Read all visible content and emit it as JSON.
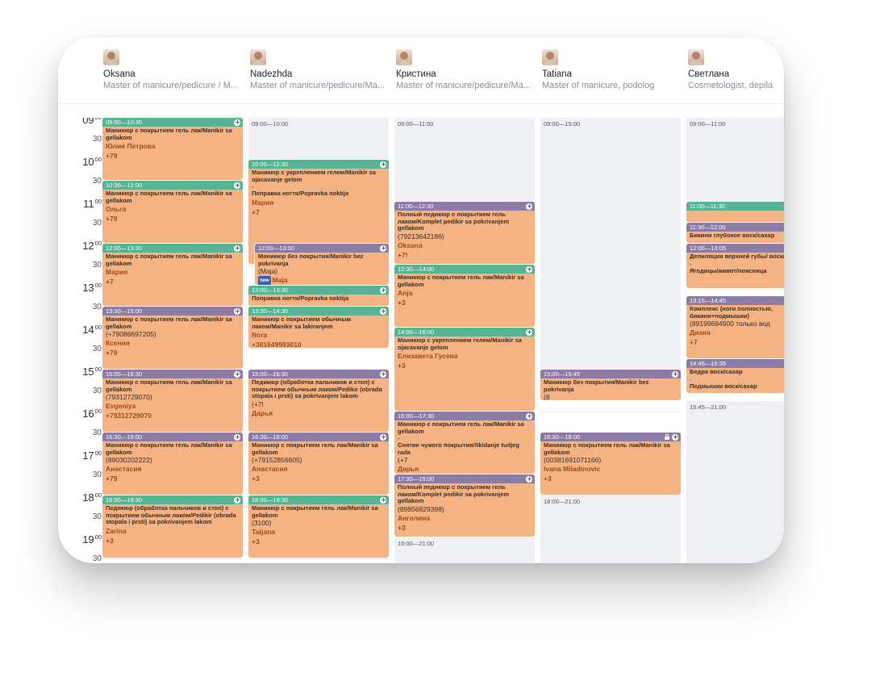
{
  "staff": [
    {
      "name": "Oksana",
      "role": "Master of manicure/pedicure / M..."
    },
    {
      "name": "Nadezhda",
      "role": "Master of manicure/pedicure/Ma..."
    },
    {
      "name": "Кристина",
      "role": "Master of manicure/pedicure/Ma..."
    },
    {
      "name": "Tatiana",
      "role": "Master of manicure, podolog"
    },
    {
      "name": "Светлана",
      "role": "Cosmetologist, depila"
    }
  ],
  "times": [
    {
      "hour": "09",
      "min": "00",
      "half": "30"
    },
    {
      "hour": "10",
      "min": "00",
      "half": "30"
    },
    {
      "hour": "11",
      "min": "00",
      "half": "30"
    },
    {
      "hour": "12",
      "min": "00",
      "half": "30"
    },
    {
      "hour": "13",
      "min": "00",
      "half": "30"
    },
    {
      "hour": "14",
      "min": "00",
      "half": "30"
    },
    {
      "hour": "15",
      "min": "00",
      "half": "30"
    },
    {
      "hour": "16",
      "min": "00",
      "half": "30"
    },
    {
      "hour": "17",
      "min": "00",
      "half": "30"
    },
    {
      "hour": "18",
      "min": "00",
      "half": "30"
    },
    {
      "hour": "19",
      "min": "00",
      "half": "30"
    }
  ],
  "columns": [
    {
      "avail": [],
      "appts": [
        {
          "time": "09:00—10:30",
          "color": "green",
          "service": "Маникюр с покрытием гель лак/Manikir sa gellakom",
          "client": "Юлия Петрова",
          "extra": "+79"
        },
        {
          "time": "10:30—12:00",
          "color": "green",
          "service": "Маникюр с покрытием гель лак/Manikir sa gellakom",
          "client": "Ольга",
          "extra": "+79"
        },
        {
          "time": "12:00—13:30",
          "color": "green",
          "service": "Маникюр с покрытием гель лак/Manikir sa gellakom",
          "client": "Мария",
          "extra": "+7"
        },
        {
          "time": "13:30—15:00",
          "color": "purple",
          "service": "Маникюр с покрытием гель лак/Manikir sa gellakom",
          "phone": "(+79086697205)",
          "client": "Ксения",
          "extra": "+79"
        },
        {
          "time": "15:00—16:30",
          "color": "purple",
          "service": "Маникюр с покрытием гель лак/Manikir sa gellakom",
          "phone": "(79312729070)",
          "client": "Evgeniya",
          "extra": "+79312729070"
        },
        {
          "time": "16:30—18:00",
          "color": "purple",
          "service": "Маникюр с покрытием гель лак/Manikir sa gellakom",
          "phone": "(89030202222)",
          "client": "Анастасия",
          "extra": "+79"
        },
        {
          "time": "18:00—19:30",
          "color": "green",
          "service": "Педикюр (обработка пальчиков и стоп) с покрытием обычным лаком/Pedikir (obrada stopala i prsti) sa pokrivanjem lakom",
          "client": "Zarina",
          "extra": "+3"
        }
      ]
    },
    {
      "avail": [
        {
          "label": "09:00—10:00"
        }
      ],
      "appts": [
        {
          "time": "10:00—12:30",
          "color": "green",
          "service": "Маникюр с укреплением гелем/Manikir sa ojacavanje gelom",
          "dash": "-",
          "service2": "Поправка ногтя/Popravka noktija",
          "client": "Мария",
          "extra": "+7"
        },
        {
          "time": "12:00—13:00",
          "color": "purple",
          "service": "Маникюр без покрытия/Manikir bez pokrivanja",
          "phone": "(Maja)",
          "badge": "new",
          "client": "Maja"
        },
        {
          "time": "13:00—13:30",
          "color": "green",
          "service": "Поправка ногтя/Popravka noktija"
        },
        {
          "time": "13:30—14:30",
          "color": "green",
          "service": "Маникюр с покрытием обычным лаком/Manikir sa lakiranjem",
          "client": "Nora",
          "extra": "+381649993010"
        },
        {
          "time": "15:00—16:30",
          "color": "purple",
          "service": "Педикюр (обработка пальчиков и стоп) с покрытием обычным лаком/Pedikir (obrada stopala i prsti) sa pokrivanjem lakom",
          "phone": "(+7!",
          "client": "Дарья"
        },
        {
          "time": "16:30—18:00",
          "color": "purple",
          "service": "Маникюр с покрытием гель лак/Manikir sa gellakom",
          "phone": "(+79152856605)",
          "client": "Анастасия",
          "extra": "+3"
        },
        {
          "time": "18:00—19:30",
          "color": "green",
          "service": "Маникюр с покрытием гель лак/Manikir sa gellakom",
          "phone": "(3100)",
          "client": "Tatjana",
          "extra": "+3"
        }
      ]
    },
    {
      "avail": [
        {
          "label": "09:00—11:00"
        },
        {
          "label": "19:00—21:00"
        }
      ],
      "appts": [
        {
          "time": "11:00—12:30",
          "color": "purple",
          "service": "Полный педикюр с покрытием гель лаком/Komplet pedikir sa pokrivanjem gellakom",
          "phone": "(79213642186)",
          "client": "Oksana",
          "extra": "+7!"
        },
        {
          "time": "12:30—14:00",
          "color": "green",
          "service": "Маникюр с покрытием гель лак/Manikir sa gellakom",
          "client": "Anja",
          "extra": "+3"
        },
        {
          "time": "14:00—16:00",
          "color": "green",
          "service": "Маникюр с укреплением гелем/Manikir sa ojacavanje gelom",
          "client": "Елизавета Гусева",
          "extra": "+3"
        },
        {
          "time": "16:00—17:30",
          "color": "purple",
          "service": "Маникюр с покрытием гель лак/Manikir sa gellakom",
          "dash": "-",
          "service2": "Снятие чужого покрытия/Skidanje tudjeg rada",
          "phone": "(+7",
          "client": "Дарья"
        },
        {
          "time": "17:30—19:00",
          "color": "purple",
          "service": "Полный педикюр с покрытием гель лаком/Komplet pedikir sa pokrivanjem gellakom",
          "phone": "(89856829398)",
          "client": "Ангелина",
          "extra": "+3"
        }
      ]
    },
    {
      "avail": [
        {
          "label": "09:00—15:00"
        },
        {
          "label": "18:00—21:00"
        }
      ],
      "appts": [
        {
          "time": "15:00—15:45",
          "color": "purple",
          "service": "Маникюр без покрытия/Manikir bez pokrivanja",
          "phone": "(8"
        },
        {
          "time": "16:30—18:00",
          "color": "purple",
          "lock": true,
          "service": "Маникюр с покрытием гель лак/Manikir sa gellakom",
          "phone": "(00381691071166)",
          "client": "Ivana Miladinovic",
          "extra": "+3"
        }
      ]
    },
    {
      "avail": [
        {
          "label": "09:00—11:00"
        },
        {
          "label": "15:45—21:00"
        }
      ],
      "appts": [
        {
          "time": "11:00—11:30",
          "color": "green"
        },
        {
          "time": "11:30—12:00",
          "color": "purple",
          "service": "Бикини глубокое воск/сахар"
        },
        {
          "time": "12:00—13:05",
          "color": "purple",
          "service": "Депиляция верхней губы/ воск/сахар",
          "dash": "-",
          "service2": "Ягодицы/живот/поясница"
        },
        {
          "time": "13:15—14:45",
          "color": "purple",
          "service": "Комплекс (ноги полностью, бикини+подмышки)",
          "phone": "(89199694900 только вод",
          "client": "Диана",
          "extra": "+7"
        },
        {
          "time": "14:45—15:35",
          "color": "purple",
          "service": "Бедра воск/сахар",
          "dash": "-",
          "service2": "Подмышки воск/сахар"
        }
      ]
    }
  ]
}
